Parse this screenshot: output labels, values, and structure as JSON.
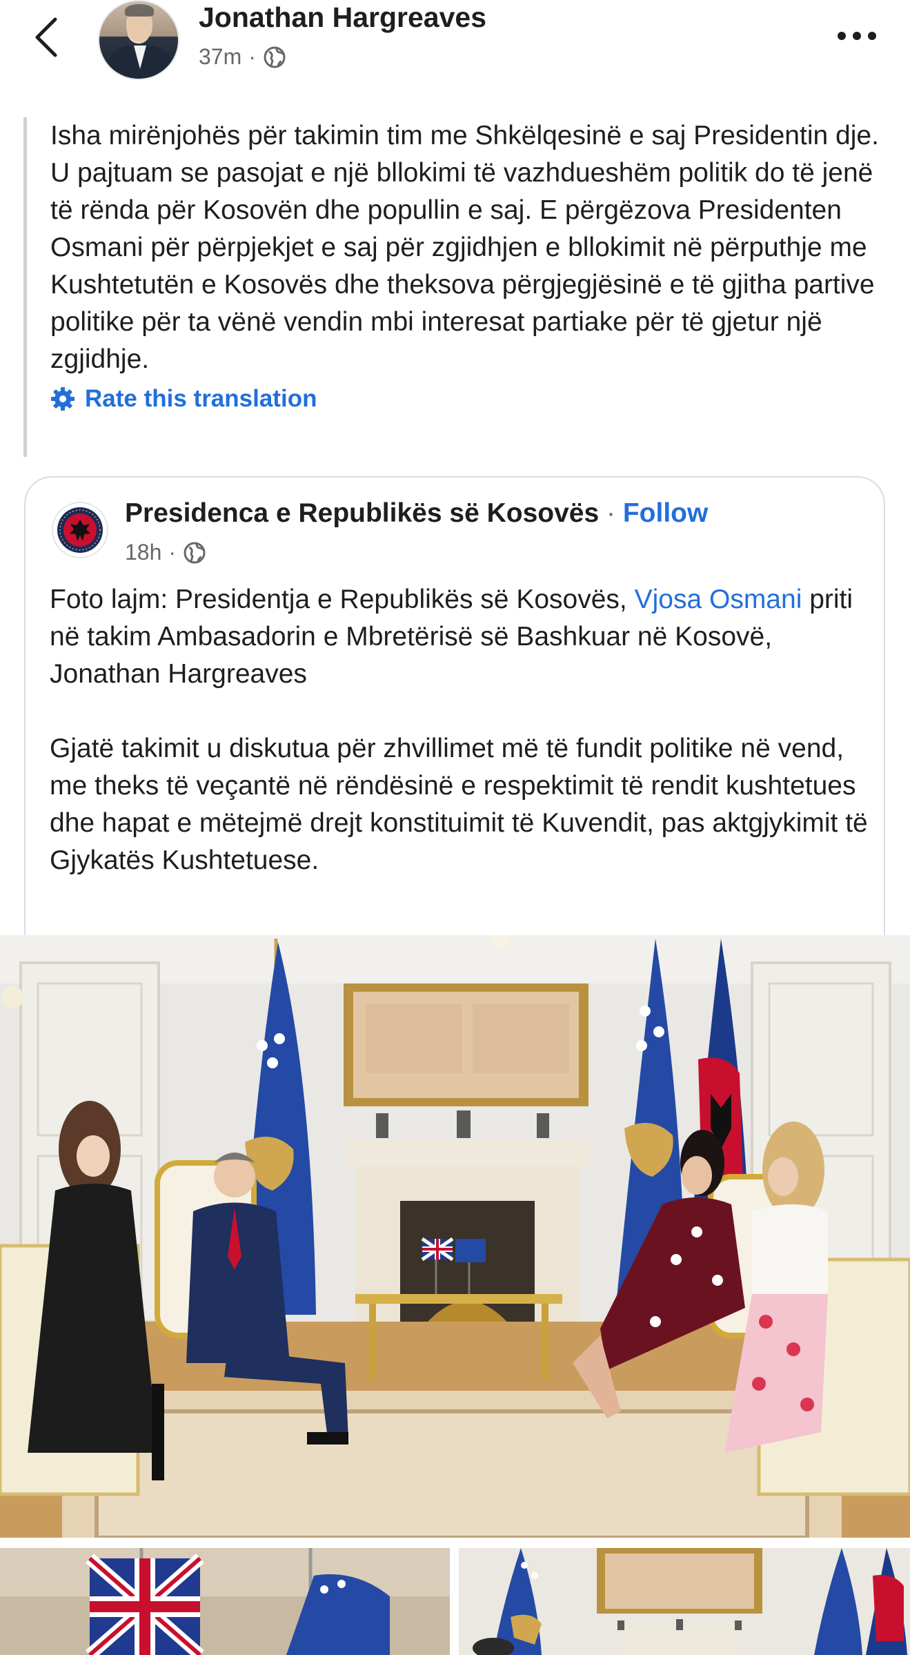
{
  "header": {
    "author_name": "Jonathan Hargreaves",
    "time_ago": "37m",
    "separator": "·",
    "audience_icon": "globe-icon",
    "back_icon": "chevron-left-icon",
    "more_icon": "more-horizontal-icon"
  },
  "translation": {
    "text": "Isha mirënjohës për takimin tim me Shkëlqesinë e saj Presidentin dje. U pajtuam se pasojat e një bllokimi të vazhdueshëm politik do të jenë të rënda për Kosovën dhe popullin e saj. E përgëzova Presidenten Osmani për përpjekjet e saj për zgjidhjen e bllokimit në përputhje me Kushtetutën e Kosovës dhe theksova përgjegjësinë e të gjitha partive politike për ta vënë vendin mbi interesat partiake për të gjetur një zgjidhje.",
    "rate_label": "Rate this translation",
    "rate_icon": "gear-icon"
  },
  "shared_post": {
    "page_name": "Presidenca e Republikës së Kosovës",
    "dot": "·",
    "follow_label": "Follow",
    "time_ago": "18h",
    "separator": "·",
    "audience_icon": "globe-icon",
    "logo_icon": "kosovo-presidency-emblem",
    "para1_before": "Foto lajm: Presidentja e Republikës së Kosovës, ",
    "para1_link": "Vjosa Osmani",
    "para1_after": " priti në takim Ambasadorin e Mbretërisë së Bashkuar në Kosovë, Jonathan Hargreaves",
    "para2": "Gjatë takimit u diskutua për zhvillimet më të fundit politike në vend, me theks të veçantë në rëndësinë e respektimit të rendit kushtetues dhe hapat e mëtejmë drejt konstituimit të Kuvendit, pas aktgjykimit të Gjykatës Kushtetuese."
  },
  "colors": {
    "link_blue": "#216fdb",
    "secondary_text": "#65676b",
    "kosovo_blue": "#244aa5",
    "kosovo_gold": "#d0a650",
    "emblem_red": "#c8102e"
  }
}
